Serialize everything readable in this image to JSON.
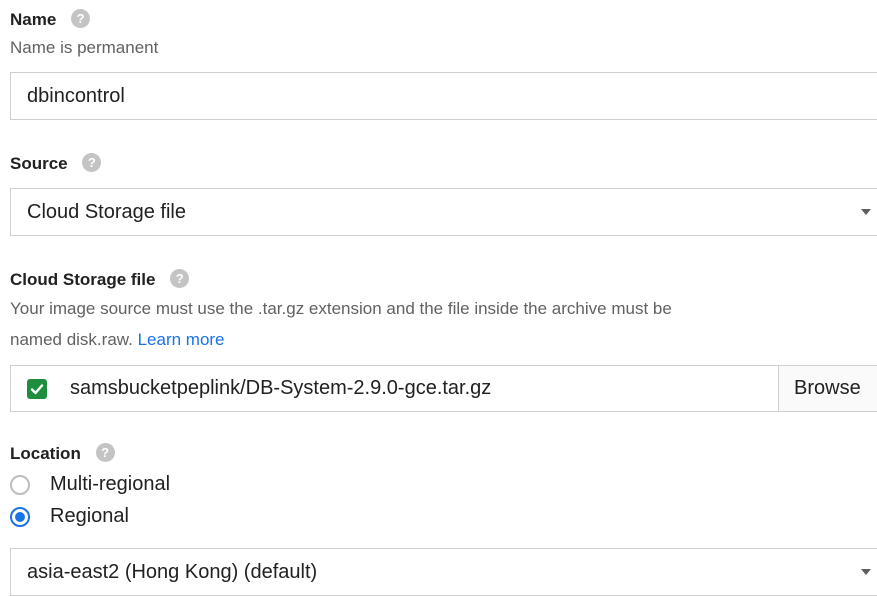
{
  "name": {
    "label": "Name",
    "hint": "Name is permanent",
    "value": "dbincontrol"
  },
  "source": {
    "label": "Source",
    "selected": "Cloud Storage file"
  },
  "cloud_storage": {
    "label": "Cloud Storage file",
    "hint_line1": "Your image source must use the .tar.gz extension and the file inside the archive must be",
    "hint_line2_prefix": "named disk.raw.",
    "learn_more": "Learn more",
    "file_value": "samsbucketpeplink/DB-System-2.9.0-gce.tar.gz",
    "browse_label": "Browse"
  },
  "location": {
    "label": "Location",
    "options": [
      {
        "label": "Multi-regional",
        "selected": false
      },
      {
        "label": "Regional",
        "selected": true
      }
    ],
    "region_selected": "asia-east2 (Hong Kong) (default)"
  },
  "icons": {
    "help": "help-icon",
    "check": "checkmark-icon",
    "dropdown": "chevron-down-icon"
  },
  "colors": {
    "accent": "#1a73e8",
    "success": "#1e8e3e"
  }
}
